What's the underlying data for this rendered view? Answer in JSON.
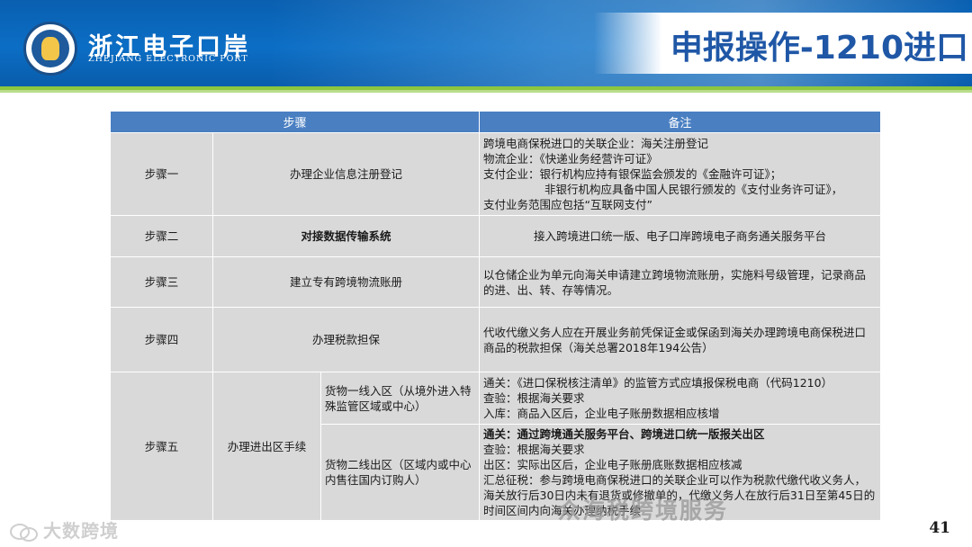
{
  "header": {
    "logo_cn": "浙江电子口岸",
    "logo_en": "ZHEJIANG ELECTRONIC PORT",
    "title": "申报操作-1210进口"
  },
  "table": {
    "headers": [
      "步骤",
      "备注"
    ],
    "rows": [
      {
        "step": "步骤一",
        "action": "办理企业信息注册登记",
        "notes": [
          "跨境电商保税进口的关联企业：海关注册登记",
          "物流企业：《快递业务经营许可证》",
          "支付企业：银行机构应持有银保监会颁发的《金融许可证》；",
          "非银行机构应具备中国人民银行颁发的《支付业务许可证》，",
          "支付业务范围应包括“互联网支付”"
        ]
      },
      {
        "step": "步骤二",
        "action": "对接数据传输系统",
        "notes": [
          "接入跨境进口统一版、电子口岸跨境电子商务通关服务平台"
        ]
      },
      {
        "step": "步骤三",
        "action": "建立专有跨境物流账册",
        "notes": [
          "以仓储企业为单元向海关申请建立跨境物流账册，实施料号级管理，记录商品的进、出、转、存等情况。"
        ]
      },
      {
        "step": "步骤四",
        "action": "办理税款担保",
        "notes": [
          "代收代缴义务人应在开展业务前凭保证金或保函到海关办理跨境电商保税进口商品的税款担保（海关总署2018年194公告）"
        ]
      },
      {
        "step": "步骤五",
        "action": "办理进出区手续",
        "sub": [
          {
            "label": "货物一线入区（从境外进入特殊监管区域或中心）",
            "notes": [
              "通关：《进口保税核注清单》的监管方式应填报保税电商（代码1210）",
              "查验：根据海关要求",
              "入库：商品入区后，企业电子账册数据相应核增"
            ]
          },
          {
            "label": "货物二线出区（区域内或中心内售往国内订购人）",
            "notes": [
              "通关：通过跨境通关服务平台、跨境进口统一版报关出区",
              "查验：根据海关要求",
              "出区：实际出区后，企业电子账册底账数据相应核减",
              "汇总征税：参与跨境电商保税进口的关联企业可以作为税款代缴代收义务人，海关放行后30日内未有退货或修撤单的，代缴义务人在放行后31日至第45日的时间区间内向海关办理纳税手续"
            ]
          }
        ]
      }
    ]
  },
  "footer": {
    "watermark_left": "大数跨境",
    "watermark_right": "众海税跨境服务",
    "page_number": "41"
  },
  "colors": {
    "header_blue": "#0b6ec5",
    "title_blue": "#1f57a6",
    "table_header": "#4a7fc2",
    "table_cell": "#d9d9d9",
    "accent_green": "#8cc63f"
  }
}
